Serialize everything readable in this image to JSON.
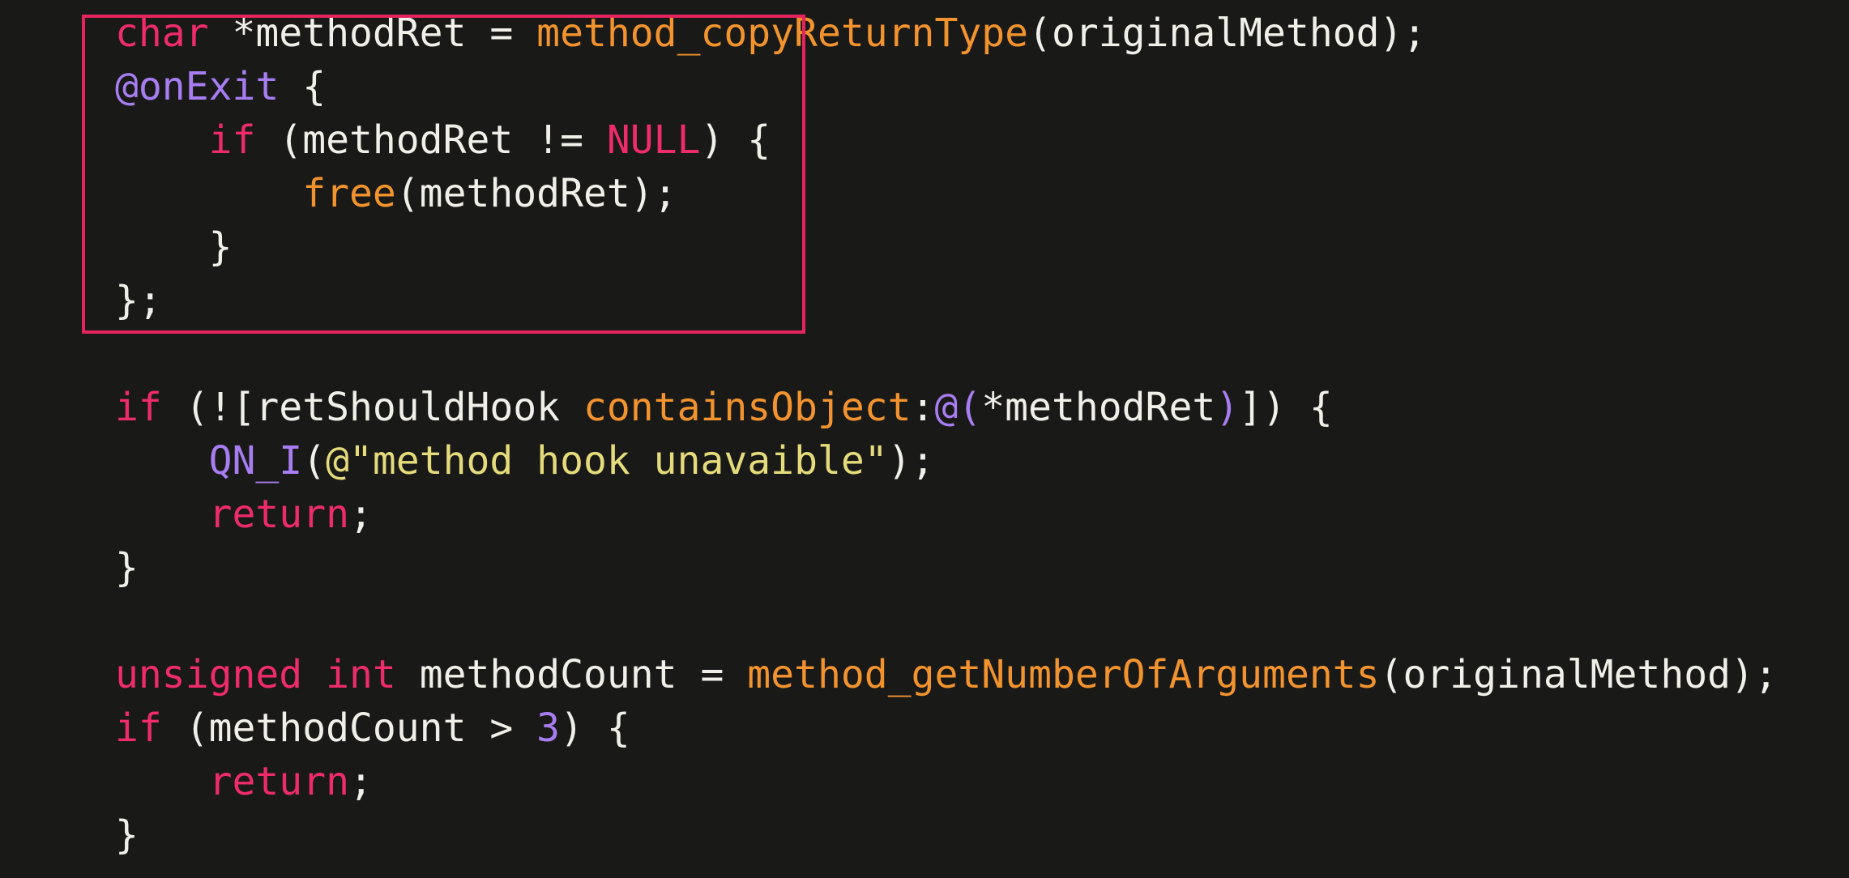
{
  "colors": {
    "background": "#191918",
    "plain": "#f0efe9",
    "keyword": "#ee2b6b",
    "function": "#f2932e",
    "macro": "#a77df1",
    "string": "#e5db7b",
    "highlight_border": "#e5245e"
  },
  "lines": [
    [
      {
        "t": "char",
        "k": "keyword"
      },
      {
        "t": " *methodRet = ",
        "k": "plain"
      },
      {
        "t": "method_copyReturnType",
        "k": "function"
      },
      {
        "t": "(originalMethod);",
        "k": "plain"
      }
    ],
    [
      {
        "t": "@onExit",
        "k": "macro"
      },
      {
        "t": " {",
        "k": "plain"
      }
    ],
    [
      {
        "t": "    ",
        "k": "plain"
      },
      {
        "t": "if",
        "k": "keyword"
      },
      {
        "t": " (methodRet != ",
        "k": "plain"
      },
      {
        "t": "NULL",
        "k": "keyword"
      },
      {
        "t": ") {",
        "k": "plain"
      }
    ],
    [
      {
        "t": "        ",
        "k": "plain"
      },
      {
        "t": "free",
        "k": "function"
      },
      {
        "t": "(methodRet);",
        "k": "plain"
      }
    ],
    [
      {
        "t": "    }",
        "k": "plain"
      }
    ],
    [
      {
        "t": "};",
        "k": "plain"
      }
    ],
    [],
    [
      {
        "t": "if",
        "k": "keyword"
      },
      {
        "t": " (![retShouldHook ",
        "k": "plain"
      },
      {
        "t": "containsObject",
        "k": "function"
      },
      {
        "t": ":",
        "k": "plain"
      },
      {
        "t": "@(",
        "k": "macro"
      },
      {
        "t": "*methodRet",
        "k": "plain"
      },
      {
        "t": ")",
        "k": "macro"
      },
      {
        "t": "]) {",
        "k": "plain"
      }
    ],
    [
      {
        "t": "    ",
        "k": "plain"
      },
      {
        "t": "QN_I",
        "k": "macro"
      },
      {
        "t": "(",
        "k": "plain"
      },
      {
        "t": "@\"method hook unavaible\"",
        "k": "string"
      },
      {
        "t": ");",
        "k": "plain"
      }
    ],
    [
      {
        "t": "    ",
        "k": "plain"
      },
      {
        "t": "return",
        "k": "keyword"
      },
      {
        "t": ";",
        "k": "plain"
      }
    ],
    [
      {
        "t": "}",
        "k": "plain"
      }
    ],
    [],
    [
      {
        "t": "unsigned",
        "k": "keyword"
      },
      {
        "t": " ",
        "k": "plain"
      },
      {
        "t": "int",
        "k": "keyword"
      },
      {
        "t": " methodCount = ",
        "k": "plain"
      },
      {
        "t": "method_getNumberOfArguments",
        "k": "function"
      },
      {
        "t": "(originalMethod);",
        "k": "plain"
      }
    ],
    [
      {
        "t": "if",
        "k": "keyword"
      },
      {
        "t": " (methodCount > ",
        "k": "plain"
      },
      {
        "t": "3",
        "k": "macro"
      },
      {
        "t": ") {",
        "k": "plain"
      }
    ],
    [
      {
        "t": "    ",
        "k": "plain"
      },
      {
        "t": "return",
        "k": "keyword"
      },
      {
        "t": ";",
        "k": "plain"
      }
    ],
    [
      {
        "t": "}",
        "k": "plain"
      }
    ]
  ]
}
